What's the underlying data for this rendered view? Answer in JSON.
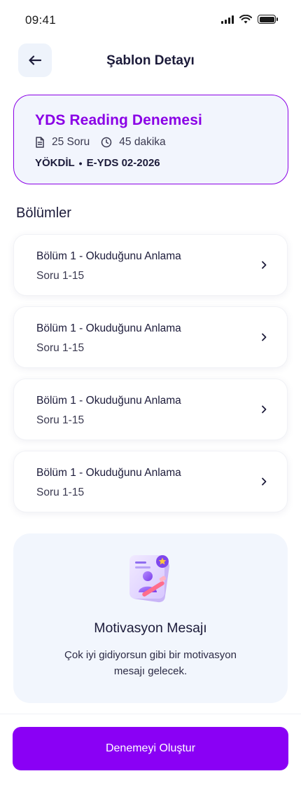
{
  "status_bar": {
    "time": "09:41"
  },
  "header": {
    "title": "Şablon Detayı"
  },
  "summary": {
    "title": "YDS Reading Denemesi",
    "question_count": "25 Soru",
    "duration": "45 dakika",
    "tag_1": "YÖKDİL",
    "separator": "•",
    "tag_2": "E-YDS 02-2026"
  },
  "sections": {
    "heading": "Bölümler",
    "items": [
      {
        "title": "Bölüm 1 - Okuduğunu Anlama",
        "range": "Soru 1-15"
      },
      {
        "title": "Bölüm 1 - Okuduğunu Anlama",
        "range": "Soru 1-15"
      },
      {
        "title": "Bölüm 1 - Okuduğunu Anlama",
        "range": "Soru 1-15"
      },
      {
        "title": "Bölüm 1 - Okuduğunu Anlama",
        "range": "Soru 1-15"
      }
    ]
  },
  "motivation": {
    "title": "Motivasyon Mesajı",
    "text": "Çok iyi gidiyorsun gibi bir motivasyon mesajı gelecek."
  },
  "footer": {
    "create_button": "Denemeyi Oluştur"
  },
  "colors": {
    "accent": "#8a00e6",
    "card_bg": "#f2f5fd",
    "text": "#1c1b3a"
  }
}
